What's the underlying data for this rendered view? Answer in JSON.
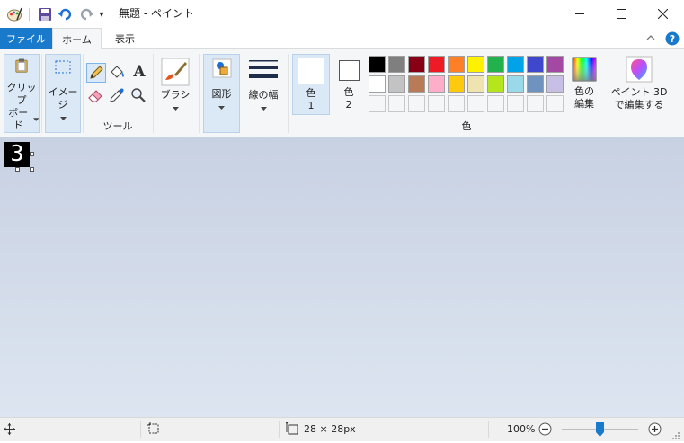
{
  "window": {
    "title": "無題 - ペイント",
    "qat_more": "▾"
  },
  "tabs": [
    {
      "label": "ファイル"
    },
    {
      "label": "ホーム"
    },
    {
      "label": "表示"
    }
  ],
  "ribbon": {
    "clipboard": {
      "line1": "クリップ",
      "line2": "ボード"
    },
    "image": {
      "label": "イメージ"
    },
    "tools": {
      "group_label": "ツール",
      "text_glyph": "A"
    },
    "brushes": {
      "label": "ブラシ"
    },
    "shapes": {
      "label": "図形"
    },
    "size": {
      "label": "線の幅"
    },
    "color1": {
      "line1": "色",
      "line2": "1"
    },
    "color2": {
      "line1": "色",
      "line2": "2"
    },
    "colors_group_label": "色",
    "edit_colors": {
      "line1": "色の",
      "line2": "編集"
    },
    "paint3d": {
      "line1": "ペイント 3D",
      "line2": "で編集する"
    },
    "palette_row1": [
      "#000000",
      "#7f7f7f",
      "#880015",
      "#ed1c24",
      "#ff7f27",
      "#fff200",
      "#22b14c",
      "#00a2e8",
      "#3f48cc",
      "#a349a4"
    ],
    "palette_row2": [
      "#ffffff",
      "#c3c3c3",
      "#b97a57",
      "#ffaec9",
      "#ffc90e",
      "#efe4b0",
      "#b5e61d",
      "#99d9ea",
      "#7092be",
      "#c8bfe7"
    ]
  },
  "canvas": {
    "drawn_glyph": "3"
  },
  "statusbar": {
    "size_text": "28 × 28px",
    "zoom": "100%"
  }
}
